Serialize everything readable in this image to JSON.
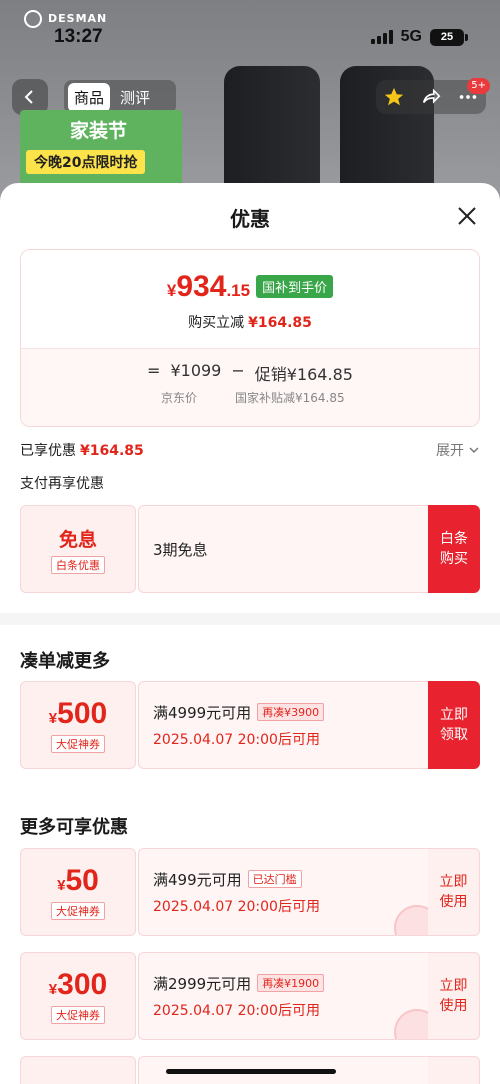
{
  "status_bar": {
    "time": "13:27",
    "network": "5G",
    "battery": "25"
  },
  "header": {
    "brand": "DESMAN",
    "tabs": [
      {
        "label": "商品"
      },
      {
        "label": "测评"
      }
    ],
    "cart_badge": "5+",
    "promo_banner": {
      "title": "家装节",
      "subtitle": "今晚20点限时抢"
    }
  },
  "sheet": {
    "title": "优惠"
  },
  "price_summary": {
    "final_currency": "¥",
    "final_int": "934",
    "final_dec": ".15",
    "final_tag": "国补到手价",
    "reduce_label": "购买立减",
    "reduce_amount": "¥164.85",
    "calc_equals": "=",
    "jd_price": "¥1099",
    "calc_minus": "−",
    "promo": "促销¥164.85",
    "jd_price_label": "京东价",
    "subsidy_label": "国家补贴减¥164.85"
  },
  "enjoyed": {
    "label": "已享优惠",
    "amount": "¥164.85",
    "expand": "展开"
  },
  "pay_section": {
    "label": "支付再享优惠"
  },
  "coupons": {
    "interest_free": {
      "title": "免息",
      "tag": "白条优惠",
      "desc": "3期免息",
      "action": "白条购买"
    },
    "bundle_title": "凑单减更多",
    "c500": {
      "currency": "¥",
      "amount": "500",
      "tag": "大促神券",
      "cond": "满4999元可用",
      "mini": "再凑¥3900",
      "date": "2025.04.07 20:00后可用",
      "action": "立即领取"
    },
    "more_title": "更多可享优惠",
    "c50": {
      "currency": "¥",
      "amount": "50",
      "tag": "大促神券",
      "cond": "满499元可用",
      "mini": "已达门槛",
      "date": "2025.04.07 20:00后可用",
      "action": "立即使用"
    },
    "c300": {
      "currency": "¥",
      "amount": "300",
      "tag": "大促神券",
      "cond": "满2999元可用",
      "mini": "再凑¥1900",
      "date": "2025.04.07 20:00后可用",
      "action": "立即使用"
    }
  },
  "colors": {
    "accent": "#e1251b",
    "button": "#e8232f",
    "gov_tag": "#3aa64a"
  }
}
